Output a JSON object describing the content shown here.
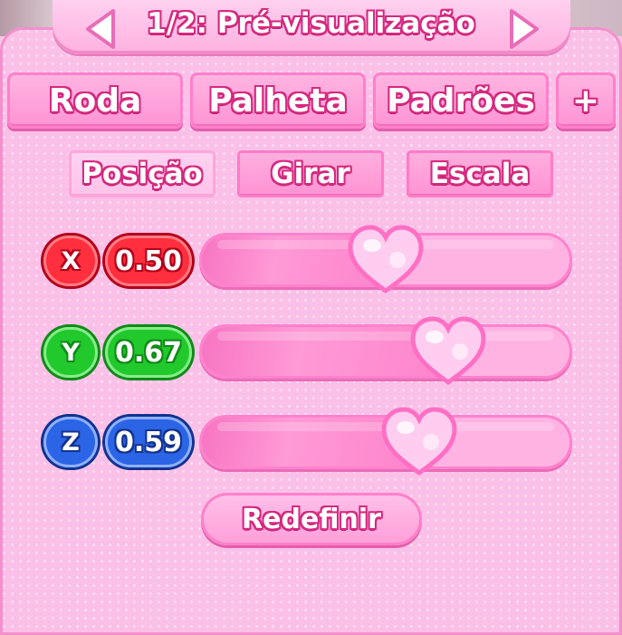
{
  "header": {
    "title": "1/2: Pré-visualização",
    "prev_icon": "arrow-left-icon",
    "next_icon": "arrow-right-icon"
  },
  "tabs": [
    {
      "label": "Roda"
    },
    {
      "label": "Palheta"
    },
    {
      "label": "Padrões"
    },
    {
      "label": "+"
    }
  ],
  "subtabs": [
    {
      "label": "Posição",
      "active": true
    },
    {
      "label": "Girar",
      "active": false
    },
    {
      "label": "Escala",
      "active": false
    }
  ],
  "sliders": [
    {
      "axis": "X",
      "value": "0.50",
      "level": 0.5,
      "color": "#ff2f3d"
    },
    {
      "axis": "Y",
      "value": "0.67",
      "level": 0.67,
      "color": "#22c92c"
    },
    {
      "axis": "Z",
      "value": "0.59",
      "level": 0.59,
      "color": "#2b65e6"
    }
  ],
  "reset_label": "Redefinir",
  "colors": {
    "panel": "#fbc0e8",
    "accent": "#d6287f",
    "tab": "#ff93d3",
    "active_subtab": "#ffc2ea"
  }
}
